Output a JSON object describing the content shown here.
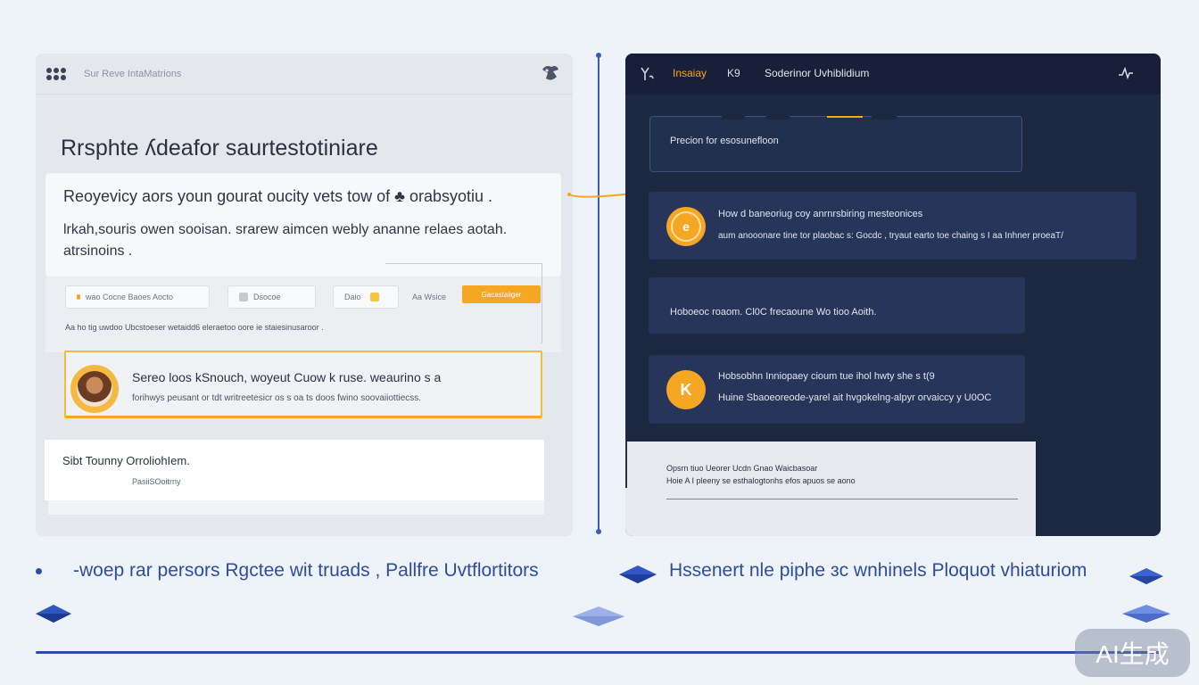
{
  "left_app": {
    "header_title": "Sur Reve IntaMatrions",
    "heading": "Rrsphte ʎdeafor saurtestotiniare",
    "intro": {
      "line1": "Reoyevicy aors youn gourat oucity vets tow of ♣ orabsyotiu .",
      "line2": "lrkah,souris owen sooisan. srarew aimcen webly ananne relaes aotah. atrsinoins ."
    },
    "toolbar": {
      "chip1": "wao Cocne Baoes Aocto",
      "chip2": "Dsocoe",
      "chip3_label": "Daio",
      "chip4": "Aa Wsice",
      "accent_button": "Gacastaiiger",
      "note": "Aa ho tig uwdoo Ubcstoeser wetaidd6 eleraetoo oore ie staiesinusaroor ."
    },
    "highlight": {
      "title": "Sereo loos kSnouch, woyeut Cuow k ruse. weaurino s a",
      "subtitle": "forihwys peusant or tdt writreetesicr os s oa ts doos fwino soovaiiottiecss."
    },
    "bottom": {
      "title": "Sibt Tounny OrroliohIem.",
      "subtitle": "PasiiSOoitrny"
    }
  },
  "right_app": {
    "tab_primary": "Insaiay",
    "tab_secondary": "K9",
    "title": "Soderinor Uvhiblidium",
    "search_card": "Precion for esosunefloon",
    "card_a": {
      "coin": "e",
      "line1": "How d baneoriug coy anrnrsbiring mesteonices",
      "line2": "aum anooonare tine tor plaobac s: Gocdc , tryaut earto toe chaing s I aa Inhner proeaT/"
    },
    "card_b": {
      "line1": "Hoboeoc roaom.    Cl0C frecaoune  Wo tioo Aoith."
    },
    "card_c": {
      "coin": "K",
      "line1": "Hobsobhn Inniopaey cioum tue ihol hwty she s t(9",
      "line2": "Huine Sbaoeoreode-yarel ait hvgokelng-alpyr   orvaiccy y U0OC"
    },
    "light_card": {
      "line1": "Opsrn tiuo Ueorer Ucdn Gnao Waicbasoar",
      "line2": "Hoie A I pleeny se esthalogtonhs efos apuos se aono"
    }
  },
  "captions": {
    "left": "-woep rar persors Rgctee wit truads , Pallfre Uvtflortitors",
    "right": "Hssenert nle piphe ɜc wnhinels Ploquot vhiaturiom"
  },
  "watermark": "AI生成",
  "colors": {
    "accent": "#f5a623",
    "dark_panel": "#1d2841",
    "primary_blue": "#2d4d9e",
    "background": "#eef2f9"
  },
  "icons": [
    "grid-icon",
    "brand-icon",
    "logo-icon",
    "pulse-icon",
    "coin-icon",
    "avatar",
    "diamond-icon"
  ]
}
